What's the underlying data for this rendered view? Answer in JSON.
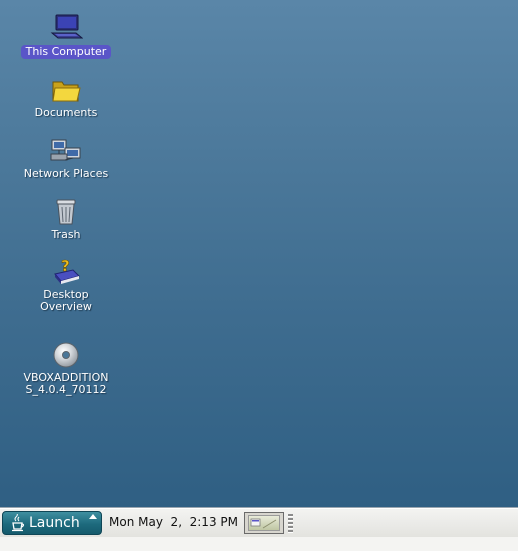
{
  "desktop": {
    "icons": [
      {
        "icon": "computer-icon",
        "label": "This Computer",
        "selected": true
      },
      {
        "icon": "folder-icon",
        "label": "Documents",
        "selected": false
      },
      {
        "icon": "network-icon",
        "label": "Network Places",
        "selected": false
      },
      {
        "icon": "trash-icon",
        "label": "Trash",
        "selected": false
      },
      {
        "icon": "help-book-icon",
        "label": "Desktop\nOverview",
        "selected": false
      },
      {
        "icon": "cd-disc-icon",
        "label": "VBOXADDITION\nS_4.0.4_70112",
        "selected": false
      }
    ]
  },
  "taskbar": {
    "launch_label": "Launch",
    "launch_icon": "java-cup-icon",
    "clock": "Mon May  2,  2:13 PM",
    "workspace_icon": "workspace-thumbnail-icon"
  },
  "colors": {
    "desktop_top": "#5a86a8",
    "desktop_bottom": "#2f5f83",
    "selection": "#5a55c8",
    "launch_button": "#1d6a7d",
    "taskbar": "#e9e9e6"
  }
}
